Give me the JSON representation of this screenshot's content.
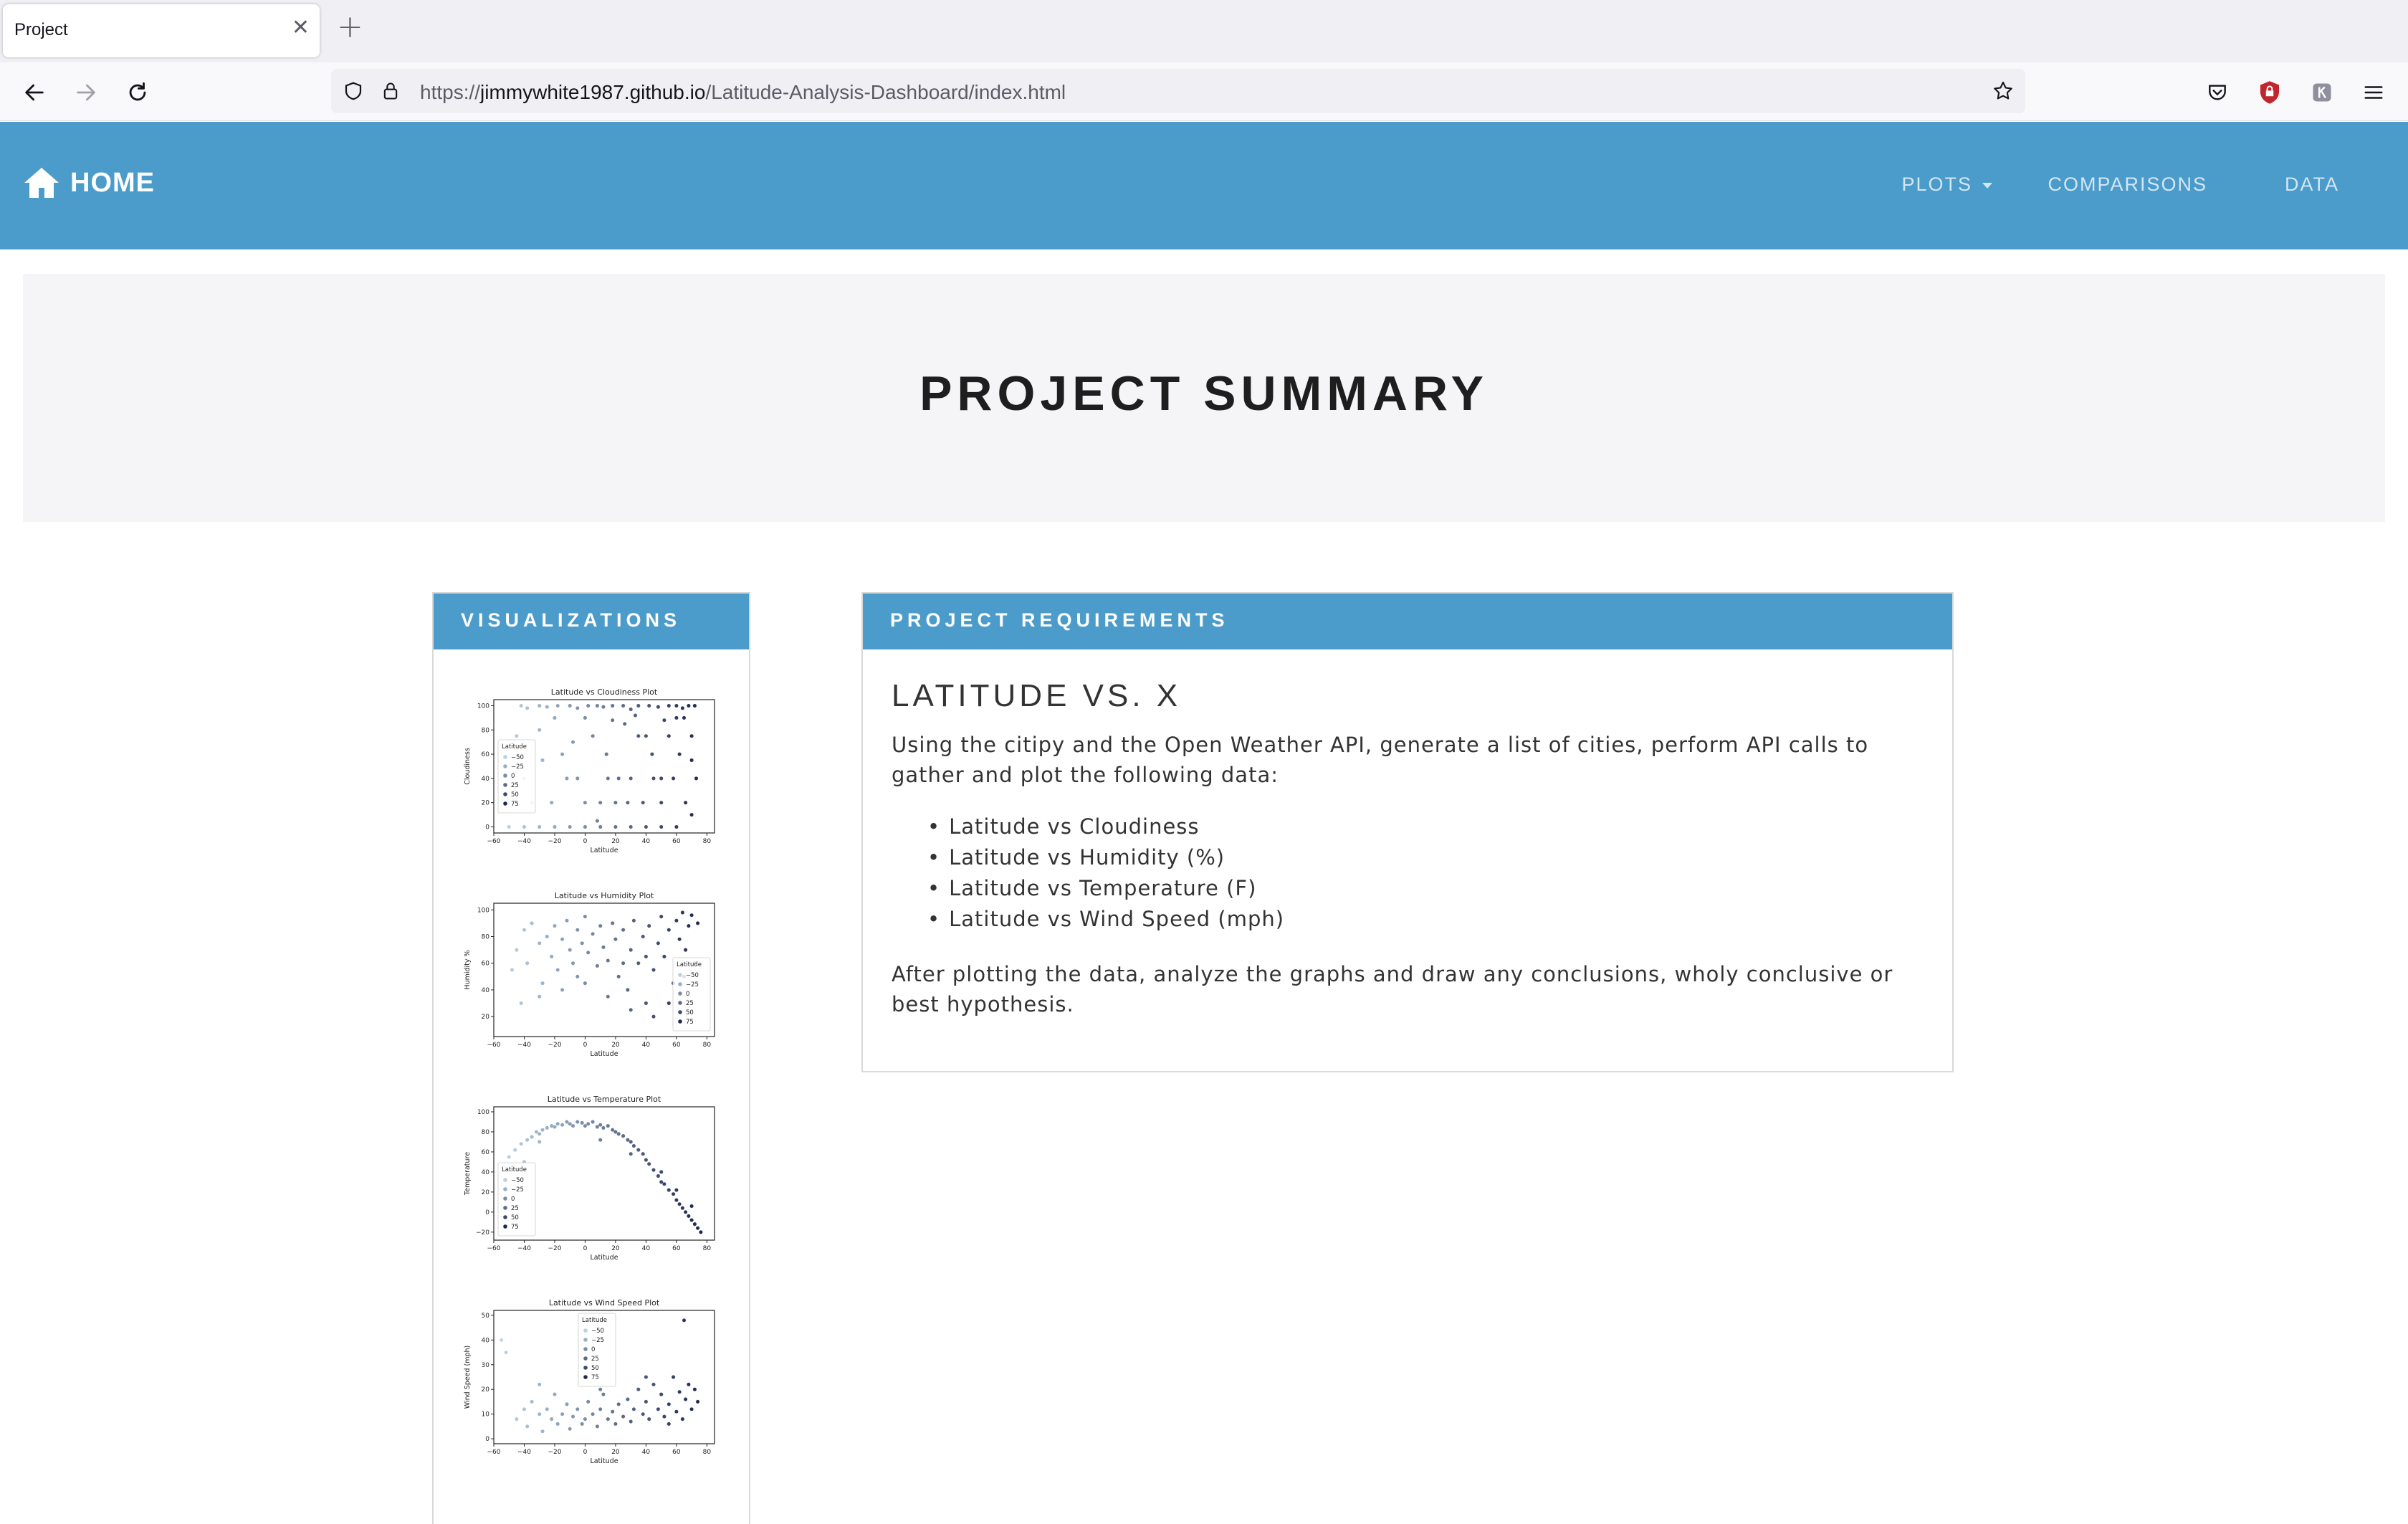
{
  "browser": {
    "tab_title": "Project",
    "url_scheme": "https://",
    "url_host": "jimmywhite1987.github.io",
    "url_path": "/Latitude-Analysis-Dashboard/index.html"
  },
  "site_nav": {
    "brand": "HOME",
    "links": [
      "PLOTS",
      "COMPARISONS",
      "DATA"
    ]
  },
  "jumbotron": {
    "title": "PROJECT SUMMARY"
  },
  "visualizations": {
    "heading": "VISUALIZATIONS"
  },
  "requirements": {
    "heading": "PROJECT REQUIREMENTS",
    "title": "LATITUDE VS. X",
    "intro": "Using the citipy and the Open Weather API, generate a list of cities, perform API calls to gather and plot the following data:",
    "items": [
      "Latitude vs Cloudiness",
      "Latitude vs Humidity (%)",
      "Latitude vs Temperature (F)",
      "Latitude vs Wind Speed (mph)"
    ],
    "conclusion": "After plotting the data, analyze the graphs and draw any conclusions, wholy conclusive or best hypothesis."
  },
  "colors": {
    "brand_blue": "#4b9ccb",
    "jumbotron_bg": "#f5f5f7"
  },
  "chart_data": [
    {
      "type": "scatter",
      "title": "Latitude vs Cloudiness Plot",
      "xlabel": "Latitude",
      "ylabel": "Cloudiness",
      "xlim": [
        -60,
        85
      ],
      "ylim": [
        -5,
        105
      ],
      "xticks": [
        -60,
        -40,
        -20,
        0,
        20,
        40,
        60,
        80
      ],
      "yticks": [
        0,
        20,
        40,
        60,
        80,
        100
      ],
      "legend": {
        "title": "Latitude",
        "entries": [
          "−50",
          "−25",
          "0",
          "25",
          "50",
          "75"
        ],
        "position": "center-left"
      },
      "points": [
        [
          -42,
          100
        ],
        [
          -38,
          98
        ],
        [
          -30,
          100
        ],
        [
          -25,
          99
        ],
        [
          -18,
          100
        ],
        [
          -10,
          100
        ],
        [
          -5,
          98
        ],
        [
          2,
          100
        ],
        [
          8,
          100
        ],
        [
          12,
          99
        ],
        [
          18,
          100
        ],
        [
          25,
          100
        ],
        [
          30,
          97
        ],
        [
          35,
          100
        ],
        [
          42,
          100
        ],
        [
          48,
          99
        ],
        [
          55,
          100
        ],
        [
          60,
          100
        ],
        [
          64,
          98
        ],
        [
          68,
          100
        ],
        [
          72,
          100
        ],
        [
          -45,
          75
        ],
        [
          -30,
          80
        ],
        [
          -15,
          60
        ],
        [
          -5,
          40
        ],
        [
          5,
          75
        ],
        [
          10,
          20
        ],
        [
          15,
          40
        ],
        [
          22,
          40
        ],
        [
          28,
          20
        ],
        [
          35,
          75
        ],
        [
          40,
          75
        ],
        [
          45,
          40
        ],
        [
          50,
          40
        ],
        [
          55,
          75
        ],
        [
          60,
          90
        ],
        [
          65,
          90
        ],
        [
          70,
          75
        ],
        [
          73,
          40
        ],
        [
          -40,
          40
        ],
        [
          -35,
          20
        ],
        [
          -22,
          20
        ],
        [
          -12,
          40
        ],
        [
          0,
          20
        ],
        [
          8,
          5
        ],
        [
          20,
          20
        ],
        [
          30,
          40
        ],
        [
          38,
          20
        ],
        [
          50,
          20
        ],
        [
          58,
          40
        ],
        [
          66,
          20
        ],
        [
          70,
          10
        ],
        [
          -50,
          0
        ],
        [
          -40,
          0
        ],
        [
          -30,
          0
        ],
        [
          -20,
          0
        ],
        [
          -10,
          0
        ],
        [
          0,
          0
        ],
        [
          10,
          0
        ],
        [
          20,
          0
        ],
        [
          30,
          0
        ],
        [
          40,
          0
        ],
        [
          50,
          0
        ],
        [
          60,
          0
        ],
        [
          -28,
          55
        ],
        [
          -8,
          70
        ],
        [
          14,
          60
        ],
        [
          26,
          85
        ],
        [
          44,
          60
        ],
        [
          62,
          60
        ],
        [
          70,
          55
        ],
        [
          -20,
          90
        ],
        [
          0,
          90
        ],
        [
          18,
          88
        ],
        [
          33,
          92
        ],
        [
          52,
          88
        ]
      ]
    },
    {
      "type": "scatter",
      "title": "Latitude vs Humidity Plot",
      "xlabel": "Latitude",
      "ylabel": "Humidity %",
      "xlim": [
        -60,
        85
      ],
      "ylim": [
        5,
        105
      ],
      "xticks": [
        -60,
        -40,
        -20,
        0,
        20,
        40,
        60,
        80
      ],
      "yticks": [
        20,
        40,
        60,
        80,
        100
      ],
      "legend": {
        "title": "Latitude",
        "entries": [
          "−50",
          "−25",
          "0",
          "25",
          "50",
          "75"
        ],
        "position": "lower-right"
      },
      "points": [
        [
          -45,
          70
        ],
        [
          -40,
          85
        ],
        [
          -38,
          60
        ],
        [
          -35,
          90
        ],
        [
          -30,
          75
        ],
        [
          -28,
          45
        ],
        [
          -25,
          80
        ],
        [
          -22,
          65
        ],
        [
          -20,
          88
        ],
        [
          -18,
          55
        ],
        [
          -15,
          78
        ],
        [
          -12,
          92
        ],
        [
          -10,
          70
        ],
        [
          -8,
          60
        ],
        [
          -5,
          85
        ],
        [
          -2,
          75
        ],
        [
          0,
          95
        ],
        [
          2,
          68
        ],
        [
          5,
          82
        ],
        [
          8,
          58
        ],
        [
          10,
          88
        ],
        [
          12,
          72
        ],
        [
          15,
          62
        ],
        [
          18,
          90
        ],
        [
          20,
          78
        ],
        [
          22,
          50
        ],
        [
          25,
          85
        ],
        [
          28,
          40
        ],
        [
          30,
          70
        ],
        [
          32,
          92
        ],
        [
          35,
          60
        ],
        [
          38,
          80
        ],
        [
          40,
          30
        ],
        [
          42,
          88
        ],
        [
          45,
          55
        ],
        [
          48,
          75
        ],
        [
          50,
          95
        ],
        [
          52,
          65
        ],
        [
          55,
          85
        ],
        [
          58,
          45
        ],
        [
          60,
          92
        ],
        [
          62,
          78
        ],
        [
          64,
          98
        ],
        [
          66,
          70
        ],
        [
          68,
          88
        ],
        [
          70,
          96
        ],
        [
          72,
          60
        ],
        [
          74,
          90
        ],
        [
          -42,
          30
        ],
        [
          -30,
          35
        ],
        [
          -15,
          40
        ],
        [
          0,
          45
        ],
        [
          15,
          35
        ],
        [
          30,
          25
        ],
        [
          45,
          20
        ],
        [
          55,
          30
        ],
        [
          65,
          50
        ],
        [
          -48,
          55
        ],
        [
          -5,
          50
        ],
        [
          25,
          60
        ],
        [
          40,
          65
        ]
      ]
    },
    {
      "type": "scatter",
      "title": "Latitude vs Temperature Plot",
      "xlabel": "Latitude",
      "ylabel": "Temperature",
      "xlim": [
        -60,
        85
      ],
      "ylim": [
        -28,
        105
      ],
      "xticks": [
        -60,
        -40,
        -20,
        0,
        20,
        40,
        60,
        80
      ],
      "yticks": [
        -20,
        0,
        20,
        40,
        60,
        80,
        100
      ],
      "legend": {
        "title": "Latitude",
        "entries": [
          "−50",
          "−25",
          "0",
          "25",
          "50",
          "75"
        ],
        "position": "lower-left"
      },
      "points": [
        [
          -50,
          55
        ],
        [
          -46,
          62
        ],
        [
          -42,
          68
        ],
        [
          -38,
          72
        ],
        [
          -35,
          75
        ],
        [
          -32,
          80
        ],
        [
          -30,
          78
        ],
        [
          -28,
          82
        ],
        [
          -25,
          84
        ],
        [
          -22,
          86
        ],
        [
          -20,
          85
        ],
        [
          -18,
          88
        ],
        [
          -15,
          87
        ],
        [
          -12,
          90
        ],
        [
          -10,
          88
        ],
        [
          -8,
          86
        ],
        [
          -5,
          90
        ],
        [
          -2,
          89
        ],
        [
          0,
          86
        ],
        [
          2,
          88
        ],
        [
          5,
          90
        ],
        [
          8,
          85
        ],
        [
          10,
          87
        ],
        [
          12,
          84
        ],
        [
          15,
          86
        ],
        [
          18,
          82
        ],
        [
          20,
          80
        ],
        [
          22,
          78
        ],
        [
          25,
          76
        ],
        [
          28,
          72
        ],
        [
          30,
          70
        ],
        [
          32,
          66
        ],
        [
          35,
          62
        ],
        [
          38,
          58
        ],
        [
          40,
          52
        ],
        [
          42,
          48
        ],
        [
          45,
          42
        ],
        [
          48,
          36
        ],
        [
          50,
          30
        ],
        [
          52,
          28
        ],
        [
          55,
          22
        ],
        [
          58,
          18
        ],
        [
          60,
          12
        ],
        [
          62,
          8
        ],
        [
          64,
          4
        ],
        [
          66,
          0
        ],
        [
          68,
          -4
        ],
        [
          70,
          -8
        ],
        [
          72,
          -12
        ],
        [
          74,
          -16
        ],
        [
          76,
          -20
        ],
        [
          -40,
          50
        ],
        [
          -30,
          70
        ],
        [
          10,
          72
        ],
        [
          30,
          58
        ],
        [
          50,
          40
        ],
        [
          60,
          22
        ],
        [
          70,
          6
        ]
      ]
    },
    {
      "type": "scatter",
      "title": "Latitude vs Wind Speed Plot",
      "xlabel": "Latitude",
      "ylabel": "Wind Speed (mph)",
      "xlim": [
        -60,
        85
      ],
      "ylim": [
        -2,
        52
      ],
      "xticks": [
        -60,
        -40,
        -20,
        0,
        20,
        40,
        60,
        80
      ],
      "yticks": [
        0,
        10,
        20,
        30,
        40,
        50
      ],
      "legend": {
        "title": "Latitude",
        "entries": [
          "−50",
          "−25",
          "0",
          "25",
          "50",
          "75"
        ],
        "position": "top-center"
      },
      "points": [
        [
          -55,
          40
        ],
        [
          -52,
          35
        ],
        [
          -45,
          8
        ],
        [
          -40,
          12
        ],
        [
          -38,
          5
        ],
        [
          -35,
          15
        ],
        [
          -30,
          10
        ],
        [
          -28,
          3
        ],
        [
          -25,
          12
        ],
        [
          -22,
          8
        ],
        [
          -20,
          18
        ],
        [
          -18,
          6
        ],
        [
          -15,
          10
        ],
        [
          -12,
          14
        ],
        [
          -10,
          4
        ],
        [
          -8,
          9
        ],
        [
          -5,
          12
        ],
        [
          -2,
          6
        ],
        [
          0,
          8
        ],
        [
          2,
          15
        ],
        [
          5,
          10
        ],
        [
          8,
          5
        ],
        [
          10,
          12
        ],
        [
          12,
          18
        ],
        [
          15,
          8
        ],
        [
          18,
          11
        ],
        [
          20,
          6
        ],
        [
          22,
          14
        ],
        [
          25,
          9
        ],
        [
          28,
          16
        ],
        [
          30,
          7
        ],
        [
          32,
          12
        ],
        [
          35,
          20
        ],
        [
          38,
          10
        ],
        [
          40,
          15
        ],
        [
          42,
          8
        ],
        [
          45,
          22
        ],
        [
          48,
          12
        ],
        [
          50,
          18
        ],
        [
          52,
          9
        ],
        [
          55,
          14
        ],
        [
          58,
          25
        ],
        [
          60,
          11
        ],
        [
          62,
          19
        ],
        [
          64,
          8
        ],
        [
          66,
          16
        ],
        [
          68,
          22
        ],
        [
          70,
          12
        ],
        [
          72,
          20
        ],
        [
          74,
          15
        ],
        [
          65,
          48
        ],
        [
          -30,
          22
        ],
        [
          10,
          20
        ],
        [
          40,
          25
        ],
        [
          55,
          6
        ]
      ]
    }
  ]
}
